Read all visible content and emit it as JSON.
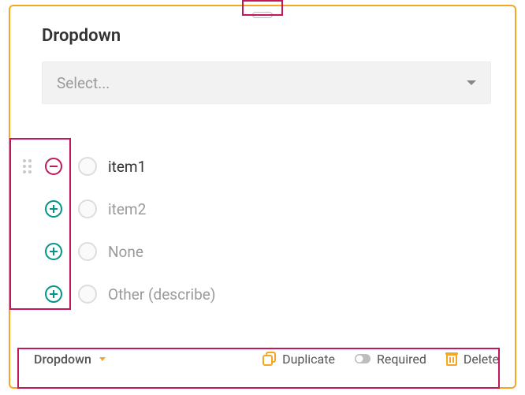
{
  "title": "Dropdown",
  "select": {
    "placeholder": "Select..."
  },
  "options": [
    {
      "label": "item1",
      "action": "remove",
      "grip": true,
      "muted": false
    },
    {
      "label": "item2",
      "action": "add",
      "grip": false,
      "muted": true
    },
    {
      "label": "None",
      "action": "add",
      "grip": false,
      "muted": true
    },
    {
      "label": "Other (describe)",
      "action": "add",
      "grip": false,
      "muted": true
    }
  ],
  "footer": {
    "type_label": "Dropdown",
    "duplicate": "Duplicate",
    "required": "Required",
    "delete": "Delete"
  },
  "colors": {
    "accent": "#f5a623",
    "highlight": "#c2185b",
    "add": "#009688"
  }
}
